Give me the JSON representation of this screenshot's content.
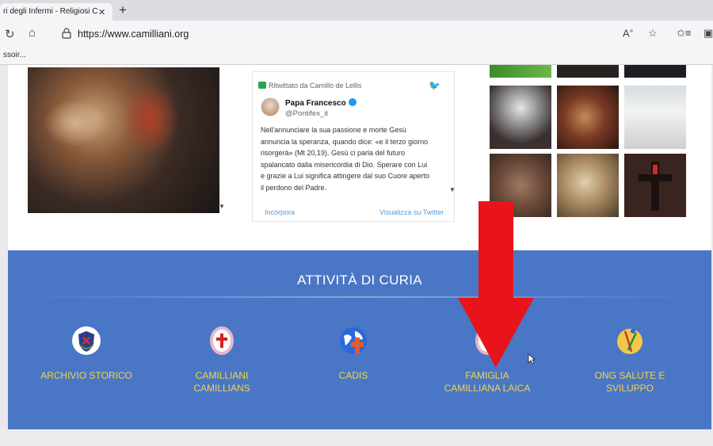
{
  "browser": {
    "tab_title": "ri degli Infermi - Religiosi C",
    "tab_close": "✕",
    "new_tab": "+",
    "url": "https://www.camilliani.org",
    "favorites_item": "ssoir..."
  },
  "tweet": {
    "retweeted_by": "Ritwittato da Camillo de Lellis",
    "author_name": "Papa Francesco",
    "author_handle": "@Pontifex_it",
    "text_lines": [
      "Nell'annunciare la sua passione e morte Gesù",
      "annuncia la speranza, quando dice: «e il terzo giorno",
      "risorgerà» (Mt 20,19). Gesù ci parla del futuro",
      "spalancato dalla misericordia di Dio. Sperare con Lui",
      "e grazie a Lui significa attingere dal suo Cuore aperto",
      "il perdono del Padre."
    ],
    "embed_label": "Incorpora",
    "view_label": "Visualizza su Twitter"
  },
  "section": {
    "title": "ATTIVITÀ DI CURIA",
    "items": [
      {
        "line1": "ARCHIVIO STORICO",
        "line2": ""
      },
      {
        "line1": "CAMILLIANI",
        "line2": "CAMILLIANS"
      },
      {
        "line1": "CADIS",
        "line2": ""
      },
      {
        "line1": "FAMIGLIA",
        "line2": "CAMILLIANA LAICA"
      },
      {
        "line1": "ONG SALUTE E",
        "line2": "SVILUPPO"
      }
    ]
  },
  "colors": {
    "section_bg": "#4a76c6",
    "label_yellow": "#f2d54a",
    "arrow_red": "#e8141a"
  }
}
